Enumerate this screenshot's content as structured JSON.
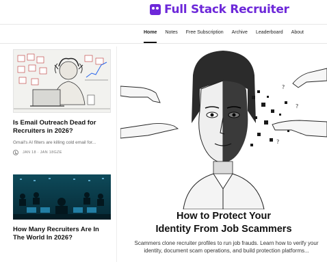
{
  "brand": {
    "name": "Full Stack Recruiter",
    "accent": "#6d28d9",
    "icon": "ghost-logo-icon"
  },
  "nav": {
    "items": [
      {
        "label": "Home",
        "active": true
      },
      {
        "label": "Notes",
        "active": false
      },
      {
        "label": "Free Subscription",
        "active": false
      },
      {
        "label": "Archive",
        "active": false
      },
      {
        "label": "Leaderboard",
        "active": false
      },
      {
        "label": "About",
        "active": false
      }
    ]
  },
  "sidebar": {
    "posts": [
      {
        "title": "Is Email Outreach Dead for Recruiters in 2026?",
        "subtitle": "Gmail's AI filters are killing cold email for...",
        "date": "JAN 18 · JAN 18GZE",
        "image": "stressed-recruiter-sketch"
      },
      {
        "title": "How Many Recruiters Are In The World In 2026?",
        "image": "dark-server-room-illustration"
      }
    ]
  },
  "hero": {
    "title_line1": "How to Protect Your",
    "title_line2": "Identity From Job Scammers",
    "subtitle": "Scammers clone recruiter profiles to run job frauds. Learn how to verify your identity, document scam operations, and build protection platforms...",
    "image": "half-face-disintegrating-sketch"
  }
}
